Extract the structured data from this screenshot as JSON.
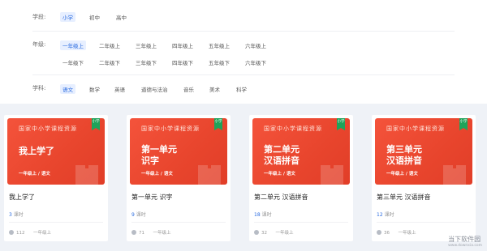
{
  "filters": {
    "stage": {
      "label": "学段:",
      "options": [
        "小学",
        "初中",
        "高中"
      ],
      "selected": "小学"
    },
    "grade": {
      "label": "年级:",
      "row1": [
        "一年级上",
        "二年级上",
        "三年级上",
        "四年级上",
        "五年级上",
        "六年级上"
      ],
      "row2": [
        "一年级下",
        "二年级下",
        "三年级下",
        "四年级下",
        "五年级下",
        "六年级下"
      ],
      "selected": "一年级上"
    },
    "subject": {
      "label": "学科:",
      "options": [
        "语文",
        "数学",
        "英语",
        "道德与法治",
        "音乐",
        "美术",
        "科学"
      ],
      "selected": "语文"
    }
  },
  "cards": [
    {
      "brand": "国家中小学课程资源",
      "tag": "小学",
      "cover_line1": "我上学了",
      "cover_line2": "",
      "grade": "一年级上 / 语文",
      "title": "我上学了",
      "lessons_num": "3",
      "lessons_unit": "课时",
      "views": "112",
      "grade_meta": "一年级上"
    },
    {
      "brand": "国家中小学课程资源",
      "tag": "小学",
      "cover_line1": "第一单元",
      "cover_line2": "识字",
      "grade": "一年级上 / 语文",
      "title": "第一单元 识字",
      "lessons_num": "9",
      "lessons_unit": "课时",
      "views": "71",
      "grade_meta": "一年级上"
    },
    {
      "brand": "国家中小学课程资源",
      "tag": "小学",
      "cover_line1": "第二单元",
      "cover_line2": "汉语拼音",
      "grade": "一年级上 / 语文",
      "title": "第二单元 汉语拼音",
      "lessons_num": "18",
      "lessons_unit": "课时",
      "views": "32",
      "grade_meta": "一年级上"
    },
    {
      "brand": "国家中小学课程资源",
      "tag": "小学",
      "cover_line1": "第三单元",
      "cover_line2": "汉语拼音",
      "grade": "一年级上 / 语文",
      "title": "第三单元 汉语拼音",
      "lessons_num": "12",
      "lessons_unit": "课时",
      "views": "36",
      "grade_meta": "一年级上"
    }
  ],
  "watermark": {
    "text": "当下软件园",
    "sub": "www.downxia.com"
  },
  "colors": {
    "accent": "#2a6be0",
    "cover_red": "#f4533b",
    "tag_green": "#1fa35a"
  }
}
